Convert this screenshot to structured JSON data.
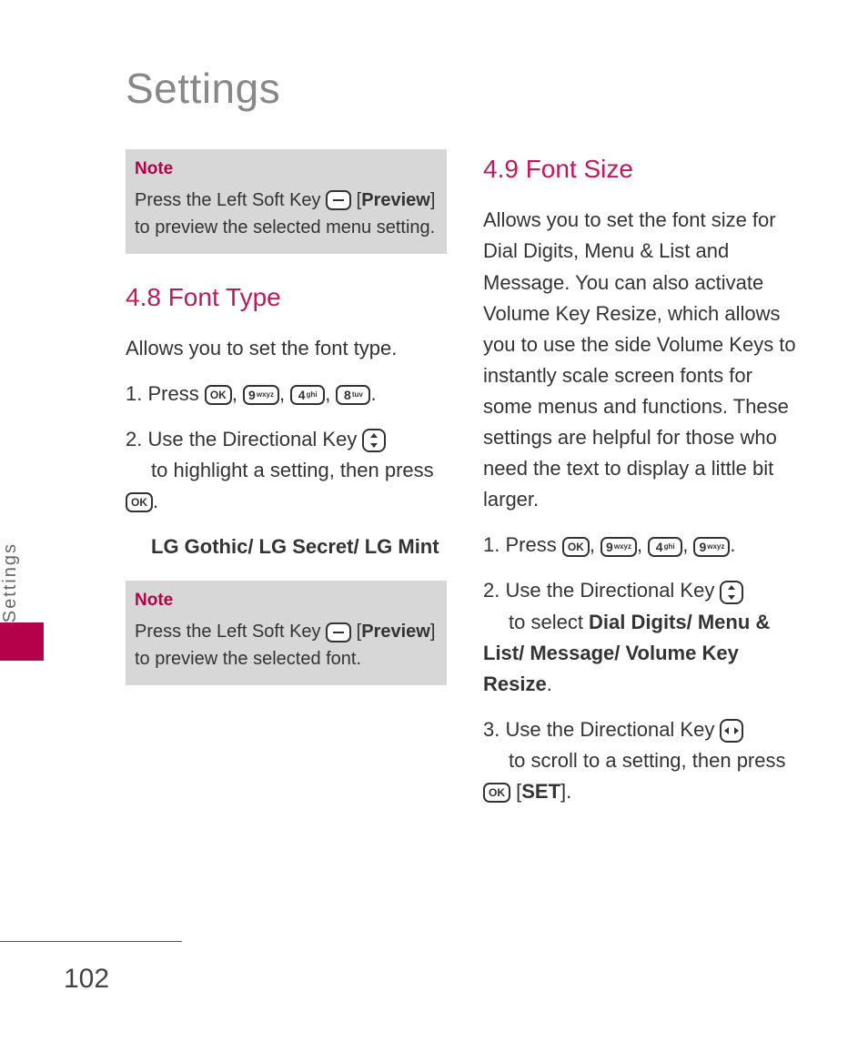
{
  "title": "Settings",
  "side_label": "Settings",
  "page_number": "102",
  "note1": {
    "label": "Note",
    "text_before": "Press the Left Soft Key ",
    "bracket_open": " [",
    "preview": "Preview",
    "bracket_close": "] ",
    "text_after": "to preview the selected menu setting."
  },
  "section48": {
    "title": "4.8 Font Type",
    "intro": "Allows you to set the font type.",
    "step1_label": "1. Press ",
    "step2_a": "2. Use the Directional Key ",
    "step2_b": " to highlight a setting, then press ",
    "font_list": "LG Gothic/ LG Secret/ LG Mint"
  },
  "keys": {
    "ok": "OK",
    "k9_big": "9",
    "k9_sub": "wxyz",
    "k4_big": "4",
    "k4_sub": "ghi",
    "k8_big": "8",
    "k8_sub": "tuv"
  },
  "note2": {
    "label": "Note",
    "text_before": "Press the Left Soft Key ",
    "bracket_open": " [",
    "preview": "Preview",
    "bracket_close": "] ",
    "text_after": "to preview the selected font."
  },
  "section49": {
    "title": "4.9 Font Size",
    "intro": "Allows you to set the font size for Dial Digits, Menu & List and Message. You can also activate Volume Key Resize, which allows you to use the side Volume Keys to instantly scale screen fonts for some menus and functions. These settings are helpful for those who need the text to display a little bit larger.",
    "step1_label": "1. Press ",
    "step2_a": "2. Use the Directional Key ",
    "step2_b": " to select ",
    "step2_bold": "Dial Digits/ Menu & List/ Message/ Volume Key Resize",
    "step2_end": ".",
    "step3_a": "3. Use the Directional Key ",
    "step3_b": " to scroll to a setting, then press ",
    "step3_bracket_open": " [",
    "step3_set": "SET",
    "step3_bracket_close": "]."
  }
}
